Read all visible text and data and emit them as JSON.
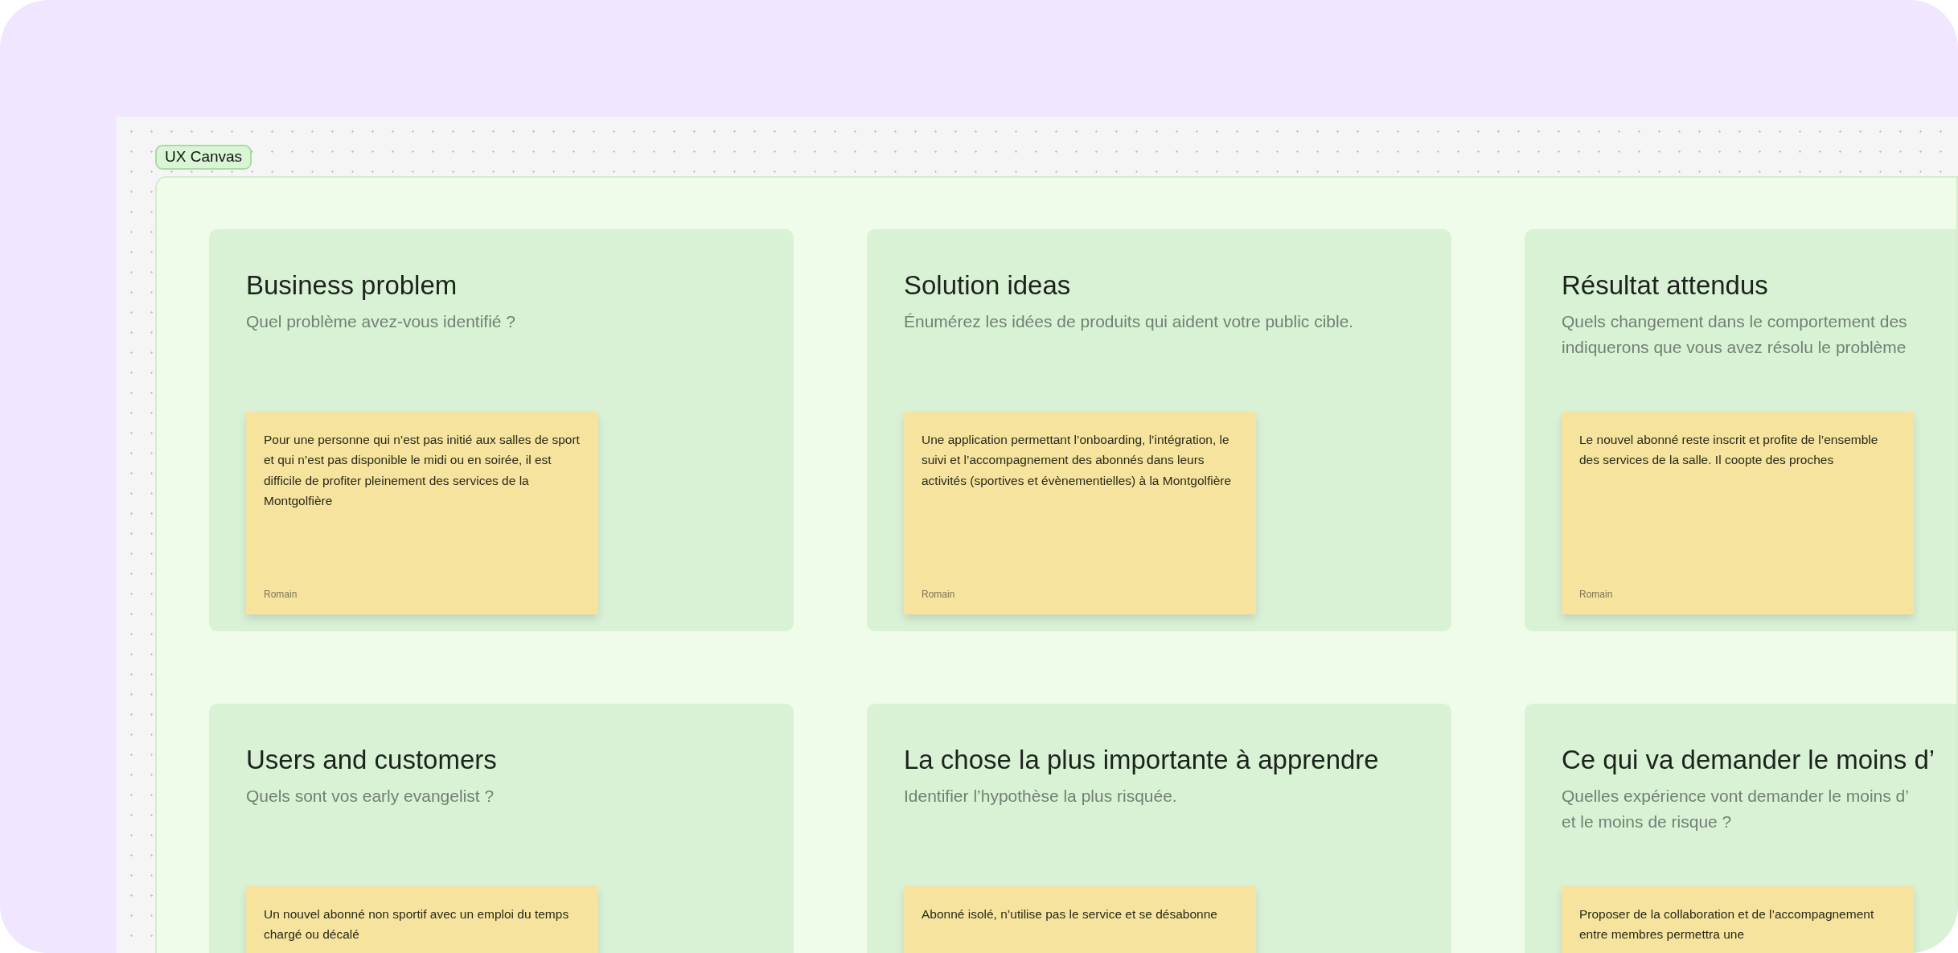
{
  "canvas": {
    "label": "UX Canvas"
  },
  "sections": [
    {
      "title": "Business problem",
      "prompt_lines": [
        "Quel problème avez-vous identifié ?"
      ],
      "notes": [
        {
          "text": "Pour une personne qui n’est pas initié aux salles de sport et qui n’est pas disponible le midi ou en soirée, il est difficile de profiter pleinement des services de la Montgolfière",
          "author": "Romain"
        }
      ]
    },
    {
      "title": "Solution ideas",
      "prompt_lines": [
        "Énumérez les idées de produits qui aident votre public cible."
      ],
      "notes": [
        {
          "text": "Une application permettant l’onboarding, l’intégration, le suivi et l’accompagnement des abonnés dans leurs activités (sportives et évènementielles) à la Montgolfière",
          "author": "Romain"
        }
      ]
    },
    {
      "title": "Résultat attendus",
      "prompt_lines": [
        "Quels changement dans le comportement des",
        "indiquerons que vous avez résolu le problème"
      ],
      "notes": [
        {
          "text": "Le nouvel abonné reste inscrit et profite de l’ensemble des services de la salle. Il coopte des proches",
          "author": "Romain"
        }
      ]
    },
    {
      "title": "Users and customers",
      "prompt_lines": [
        "Quels sont vos early evangelist ?"
      ],
      "notes": [
        {
          "text": "Un nouvel abonné non sportif avec un emploi du temps chargé ou décalé"
        }
      ]
    },
    {
      "title": "La chose la plus importante à apprendre",
      "prompt_lines": [
        "Identifier l’hypothèse la plus risquée."
      ],
      "notes": [
        {
          "text": "Abonné isolé, n’utilise pas le service et se désabonne"
        }
      ]
    },
    {
      "title": "Ce qui va demander le moins d’",
      "prompt_lines": [
        "Quelles expérience vont demander le moins d’",
        "et le moins de risque ?"
      ],
      "notes": [
        {
          "text": "Proposer de la collaboration et de l’accompagnement entre membres permettra une"
        }
      ]
    }
  ]
}
